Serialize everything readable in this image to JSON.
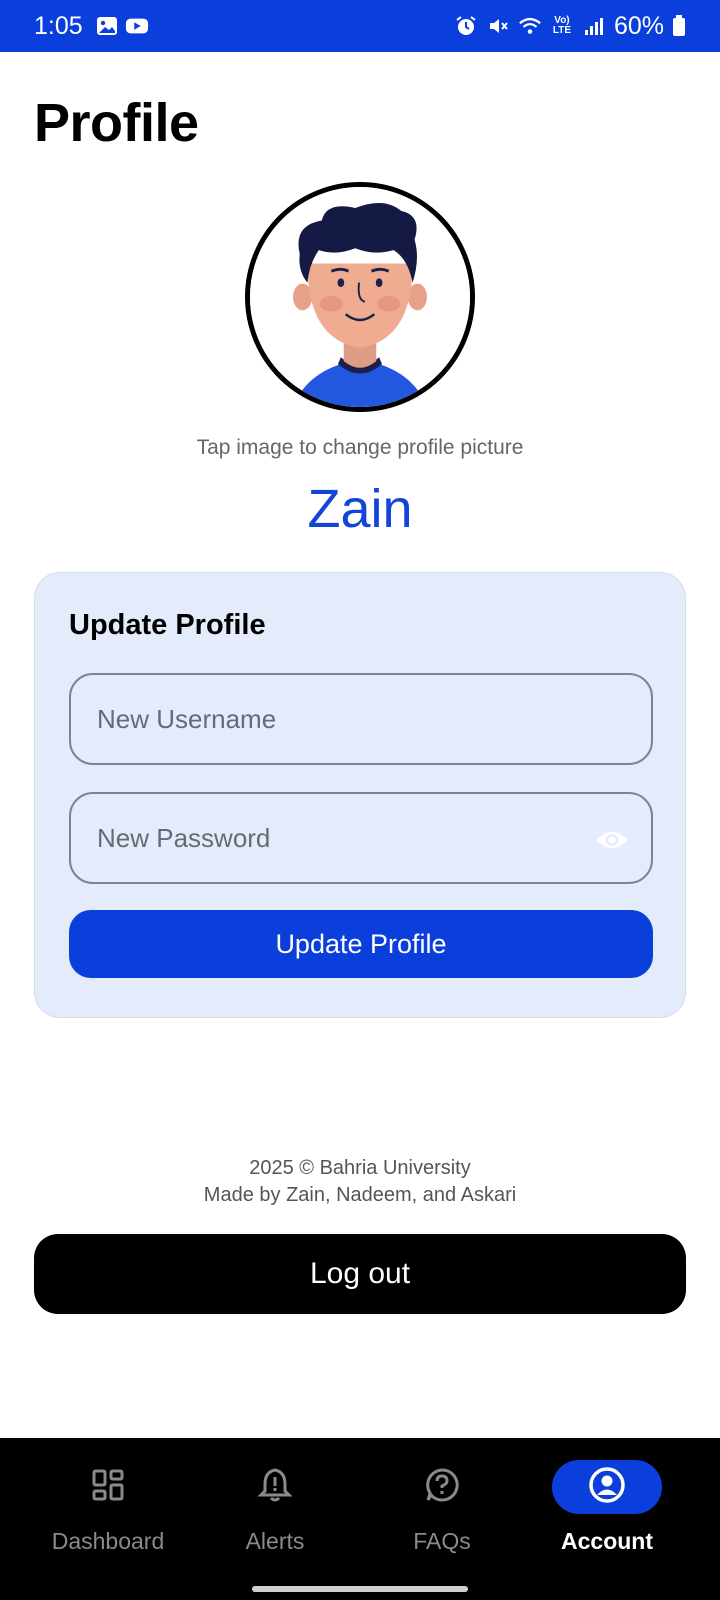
{
  "status_bar": {
    "time": "1:05",
    "battery": "60%",
    "left_icons": [
      "image-icon",
      "youtube-icon"
    ],
    "right_icons": [
      "alarm-icon",
      "mute-icon",
      "wifi-icon",
      "volte-icon",
      "signal-icon",
      "battery-icon"
    ],
    "volte_line1": "Vo)",
    "volte_line2": "LTE"
  },
  "page": {
    "title": "Profile"
  },
  "profile": {
    "avatar_icon": "avatar-illustration",
    "tap_hint": "Tap image to change profile picture",
    "username": "Zain"
  },
  "update_card": {
    "title": "Update Profile",
    "username_placeholder": "New Username",
    "password_placeholder": "New Password",
    "password_toggle_icon": "eye-icon",
    "submit_label": "Update Profile"
  },
  "footer": {
    "line1": "2025 © Bahria University",
    "line2": "Made by Zain, Nadeem, and Askari"
  },
  "logout_label": "Log out",
  "nav": {
    "items": [
      {
        "label": "Dashboard",
        "icon": "dashboard-icon",
        "active": false
      },
      {
        "label": "Alerts",
        "icon": "bell-icon",
        "active": false
      },
      {
        "label": "FAQs",
        "icon": "help-icon",
        "active": false
      },
      {
        "label": "Account",
        "icon": "account-icon",
        "active": true
      }
    ]
  },
  "colors": {
    "accent": "#0a3fdc",
    "username": "#1445d6",
    "card_bg": "#e4ebfb",
    "nav_bg": "#000000"
  }
}
